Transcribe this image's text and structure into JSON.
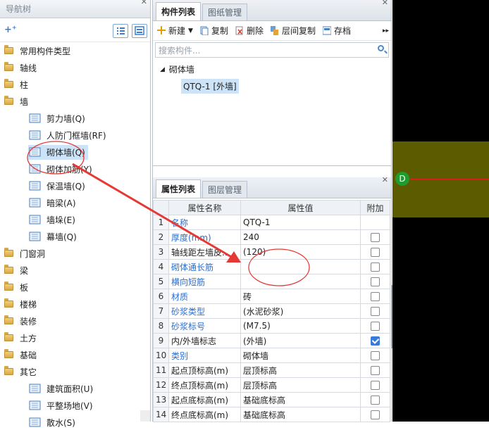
{
  "nav": {
    "title": "导航树",
    "items": [
      {
        "label": "常用构件类型",
        "icon": "folder-icon"
      },
      {
        "label": "轴线",
        "icon": "folder-icon"
      },
      {
        "label": "柱",
        "icon": "folder-icon"
      },
      {
        "label": "墙",
        "icon": "folder-icon"
      },
      {
        "label": "剪力墙(Q)",
        "icon": "shear-wall-icon"
      },
      {
        "label": "人防门框墙(RF)",
        "icon": "civil-defense-door-frame-icon"
      },
      {
        "label": "砌体墙(Q)",
        "icon": "masonry-wall-icon",
        "selected": true
      },
      {
        "label": "砌体加筋(Y)",
        "icon": "masonry-rebar-icon"
      },
      {
        "label": "保温墙(Q)",
        "icon": "insulation-wall-icon"
      },
      {
        "label": "暗梁(A)",
        "icon": "hidden-beam-icon"
      },
      {
        "label": "墙垛(E)",
        "icon": "wall-pier-icon"
      },
      {
        "label": "幕墙(Q)",
        "icon": "curtain-wall-icon"
      },
      {
        "label": "门窗洞",
        "icon": "folder-icon"
      },
      {
        "label": "梁",
        "icon": "folder-icon"
      },
      {
        "label": "板",
        "icon": "folder-icon"
      },
      {
        "label": "楼梯",
        "icon": "folder-icon"
      },
      {
        "label": "装修",
        "icon": "folder-icon"
      },
      {
        "label": "土方",
        "icon": "folder-icon"
      },
      {
        "label": "基础",
        "icon": "folder-icon"
      },
      {
        "label": "其它",
        "icon": "folder-icon"
      },
      {
        "label": "建筑面积(U)",
        "icon": "building-area-icon"
      },
      {
        "label": "平整场地(V)",
        "icon": "site-leveling-icon"
      },
      {
        "label": "散水(S)",
        "icon": "apron-icon"
      }
    ]
  },
  "component_list": {
    "tabs": [
      "构件列表",
      "图纸管理"
    ],
    "toolbar": {
      "new": "新建",
      "copy": "复制",
      "delete": "删除",
      "floor_copy": "层间复制",
      "archive": "存档"
    },
    "search_placeholder": "搜索构件...",
    "group": "砌体墙",
    "item": "QTQ-1 [外墙]"
  },
  "property_list": {
    "tabs": [
      "属性列表",
      "图层管理"
    ],
    "headers": [
      "属性名称",
      "属性值",
      "附加"
    ],
    "rows": [
      {
        "n": "1",
        "name": "名称",
        "value": "QTQ-1",
        "blue": true,
        "check": null
      },
      {
        "n": "2",
        "name": "厚度(mm)",
        "value": "240",
        "blue": true,
        "check": false
      },
      {
        "n": "3",
        "name": "轴线距左墙皮...",
        "value": "(120)",
        "blue": false,
        "check": false
      },
      {
        "n": "4",
        "name": "砌体通长筋",
        "value": "",
        "blue": true,
        "check": false
      },
      {
        "n": "5",
        "name": "横向短筋",
        "value": "",
        "blue": true,
        "check": false
      },
      {
        "n": "6",
        "name": "材质",
        "value": "砖",
        "blue": true,
        "check": false
      },
      {
        "n": "7",
        "name": "砂浆类型",
        "value": "(水泥砂浆)",
        "blue": true,
        "check": false
      },
      {
        "n": "8",
        "name": "砂浆标号",
        "value": "(M7.5)",
        "blue": true,
        "check": false
      },
      {
        "n": "9",
        "name": "内/外墙标志",
        "value": "(外墙)",
        "blue": false,
        "check": true
      },
      {
        "n": "10",
        "name": "类别",
        "value": "砌体墙",
        "blue": true,
        "check": false
      },
      {
        "n": "11",
        "name": "起点顶标高(m)",
        "value": "层顶标高",
        "blue": false,
        "check": false
      },
      {
        "n": "12",
        "name": "终点顶标高(m)",
        "value": "层顶标高",
        "blue": false,
        "check": false
      },
      {
        "n": "13",
        "name": "起点底标高(m)",
        "value": "基础底标高",
        "blue": false,
        "check": false
      },
      {
        "n": "14",
        "name": "终点底标高(m)",
        "value": "基础底标高",
        "blue": false,
        "check": false
      }
    ]
  },
  "canvas": {
    "axis_label": "D"
  },
  "colors": {
    "accent": "#2b6fcf",
    "selection": "#cde4f8",
    "canvas_band": "#5c5b00",
    "annotation": "#e53935"
  }
}
